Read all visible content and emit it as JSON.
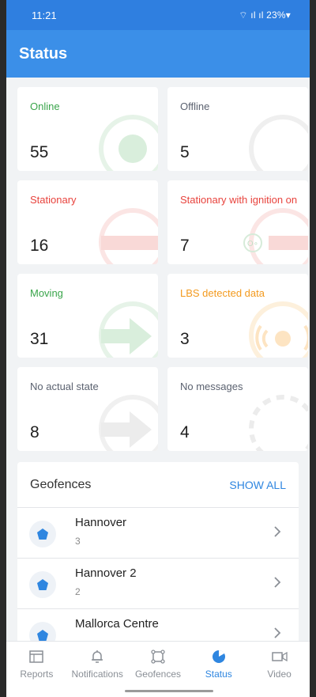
{
  "statusbar": {
    "time": "11:21",
    "indicators": "🛰 ▕▕ 23%↓"
  },
  "appbar": {
    "title": "Status"
  },
  "cards": [
    {
      "label": "Online",
      "count": "55",
      "color": "#3aa54b",
      "icon": "online-circle-icon"
    },
    {
      "label": "Offline",
      "count": "5",
      "color": "#5b6270",
      "icon": "offline-circle-icon"
    },
    {
      "label": "Stationary",
      "count": "16",
      "color": "#e8433d",
      "icon": "stationary-icon"
    },
    {
      "label": "Stationary with ignition on",
      "count": "7",
      "color": "#e8433d",
      "icon": "ignition-key-icon"
    },
    {
      "label": "Moving",
      "count": "31",
      "color": "#3aa54b",
      "icon": "moving-arrow-icon"
    },
    {
      "label": "LBS detected data",
      "count": "3",
      "color": "#f39a1e",
      "icon": "lbs-signal-icon"
    },
    {
      "label": "No actual state",
      "count": "8",
      "color": "#5b6270",
      "icon": "no-state-arrow-icon"
    },
    {
      "label": "No messages",
      "count": "4",
      "color": "#5b6270",
      "icon": "no-messages-dashed-circle-icon"
    }
  ],
  "geofences": {
    "title": "Geofences",
    "show_all": "SHOW ALL",
    "items": [
      {
        "name": "Hannover",
        "count": "3"
      },
      {
        "name": "Hannover 2",
        "count": "2"
      },
      {
        "name": "Mallorca Centre",
        "count": ""
      }
    ]
  },
  "tabs": [
    {
      "label": "Reports",
      "icon": "reports-icon",
      "active": false
    },
    {
      "label": "Notifications",
      "icon": "bell-icon",
      "active": false
    },
    {
      "label": "Geofences",
      "icon": "geofence-icon",
      "active": false
    },
    {
      "label": "Status",
      "icon": "status-pie-icon",
      "active": true
    },
    {
      "label": "Video",
      "icon": "video-icon",
      "active": false
    }
  ],
  "colors": {
    "accent": "#3b8fe8",
    "active_tab": "#2f86e0"
  }
}
